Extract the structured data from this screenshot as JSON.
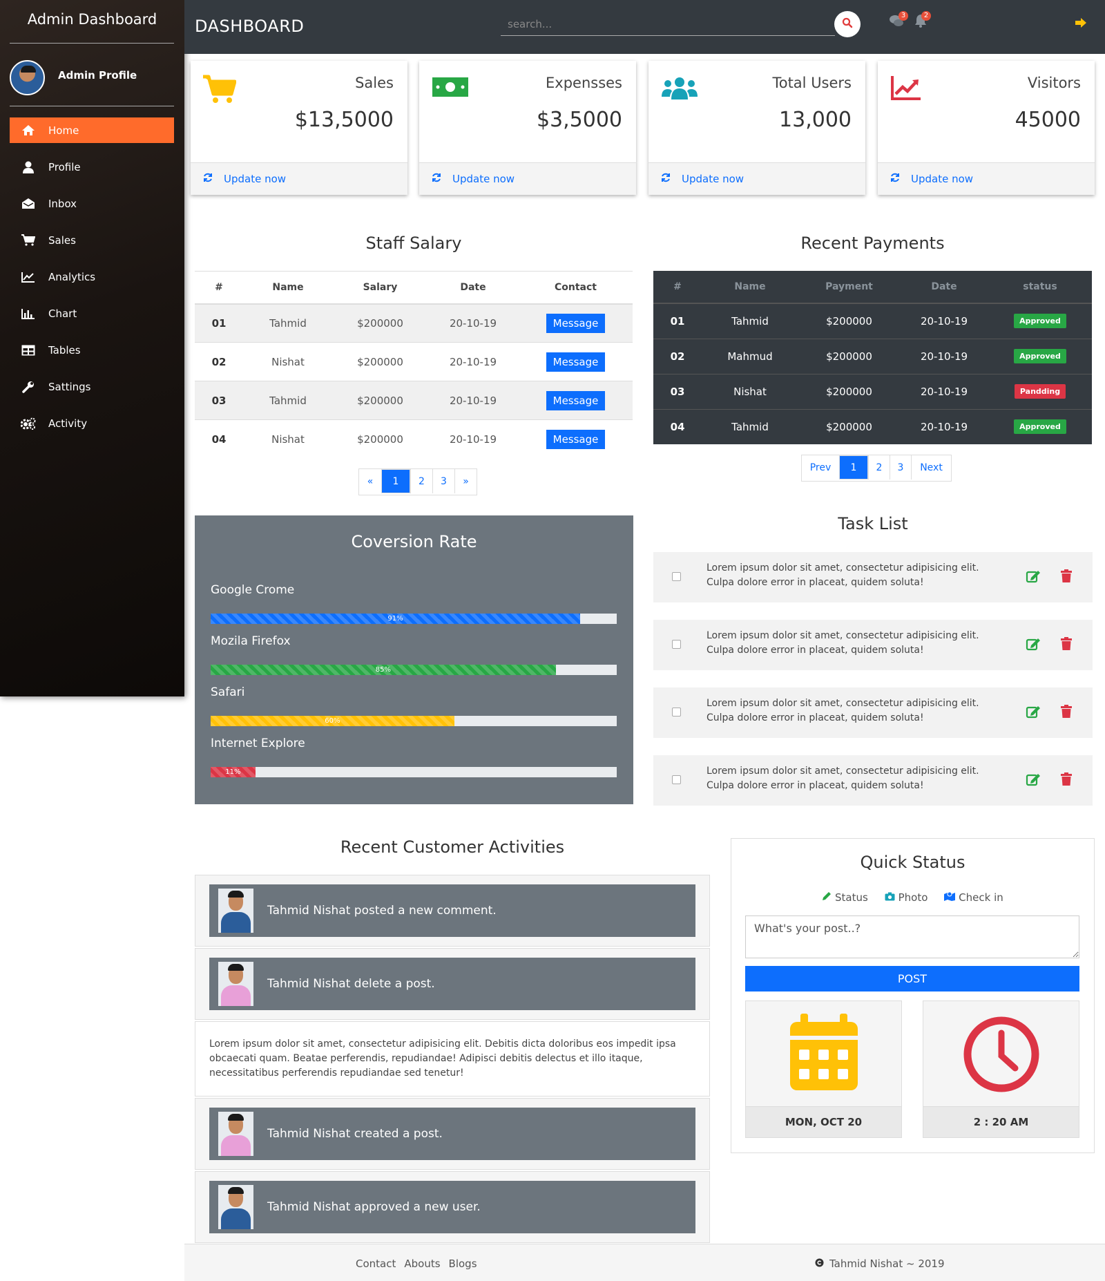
{
  "sidebar": {
    "title": "Admin Dashboard",
    "profile_name": "Admin Profile",
    "items": [
      {
        "label": "Home",
        "icon": "home-icon",
        "active": true
      },
      {
        "label": "Profile",
        "icon": "user-icon"
      },
      {
        "label": "Inbox",
        "icon": "envelope-open-icon"
      },
      {
        "label": "Sales",
        "icon": "cart-icon"
      },
      {
        "label": "Analytics",
        "icon": "line-chart-icon"
      },
      {
        "label": "Chart",
        "icon": "bar-chart-icon"
      },
      {
        "label": "Tables",
        "icon": "table-icon"
      },
      {
        "label": "Sattings",
        "icon": "wrench-icon"
      },
      {
        "label": "Activity",
        "icon": "cogs-icon"
      }
    ]
  },
  "topbar": {
    "title": "DASHBOARD",
    "search_placeholder": "search...",
    "comments_badge": "3",
    "bell_badge": "2"
  },
  "cards": [
    {
      "label": "Sales",
      "value": "$13,5000",
      "icon": "cart-icon",
      "color": "#ffc107",
      "footer": "Update now"
    },
    {
      "label": "Expensses",
      "value": "$3,5000",
      "icon": "money-icon",
      "color": "#28a745",
      "footer": "Update now"
    },
    {
      "label": "Total Users",
      "value": "13,000",
      "icon": "users-icon",
      "color": "#17a2b8",
      "footer": "Update now"
    },
    {
      "label": "Visitors",
      "value": "45000",
      "icon": "chart-line-icon",
      "color": "#dc3545",
      "footer": "Update now"
    }
  ],
  "staff_salary": {
    "title": "Staff Salary",
    "headers": [
      "#",
      "Name",
      "Salary",
      "Date",
      "Contact"
    ],
    "rows": [
      {
        "id": "01",
        "name": "Tahmid",
        "salary": "$200000",
        "date": "20-10-19",
        "action": "Message"
      },
      {
        "id": "02",
        "name": "Nishat",
        "salary": "$200000",
        "date": "20-10-19",
        "action": "Message"
      },
      {
        "id": "03",
        "name": "Tahmid",
        "salary": "$200000",
        "date": "20-10-19",
        "action": "Message"
      },
      {
        "id": "04",
        "name": "Nishat",
        "salary": "$200000",
        "date": "20-10-19",
        "action": "Message"
      }
    ],
    "pager": [
      "«",
      "1",
      "2",
      "3",
      "»"
    ]
  },
  "payments": {
    "title": "Recent Payments",
    "headers": [
      "#",
      "Name",
      "Payment",
      "Date",
      "status"
    ],
    "rows": [
      {
        "id": "01",
        "name": "Tahmid",
        "payment": "$200000",
        "date": "20-10-19",
        "status": "Approved",
        "color": "#28a745"
      },
      {
        "id": "02",
        "name": "Mahmud",
        "payment": "$200000",
        "date": "20-10-19",
        "status": "Approved",
        "color": "#28a745"
      },
      {
        "id": "03",
        "name": "Nishat",
        "payment": "$200000",
        "date": "20-10-19",
        "status": "Pandding",
        "color": "#dc3545"
      },
      {
        "id": "04",
        "name": "Tahmid",
        "payment": "$200000",
        "date": "20-10-19",
        "status": "Approved",
        "color": "#28a745"
      }
    ],
    "pager": [
      "Prev",
      "1",
      "2",
      "3",
      "Next"
    ]
  },
  "conversion": {
    "title": "Coversion Rate",
    "bars": [
      {
        "label": "Google Crome",
        "percent": 91,
        "text": "91%",
        "color": "#0d6efd"
      },
      {
        "label": "Mozila Firefox",
        "percent": 85,
        "text": "85%",
        "color": "#28a745"
      },
      {
        "label": "Safari",
        "percent": 60,
        "text": "60%",
        "color": "#ffc107"
      },
      {
        "label": "Internet Explore",
        "percent": 11,
        "text": "11%",
        "color": "#dc3545"
      }
    ]
  },
  "tasks": {
    "title": "Task List",
    "items": [
      {
        "text": "Lorem ipsum dolor sit amet, consectetur adipisicing elit. Culpa dolore error in placeat, quidem soluta!"
      },
      {
        "text": "Lorem ipsum dolor sit amet, consectetur adipisicing elit. Culpa dolore error in placeat, quidem soluta!"
      },
      {
        "text": "Lorem ipsum dolor sit amet, consectetur adipisicing elit. Culpa dolore error in placeat, quidem soluta!"
      },
      {
        "text": "Lorem ipsum dolor sit amet, consectetur adipisicing elit. Culpa dolore error in placeat, quidem soluta!"
      }
    ]
  },
  "activities": {
    "title": "Recent Customer Activities",
    "items": [
      {
        "text": "Tahmid Nishat posted a new comment.",
        "shirt": "#2b5d9a"
      },
      {
        "text": "Tahmid Nishat delete a post.",
        "shirt": "#e8a0d8"
      },
      {
        "body": "Lorem ipsum dolor sit amet, consectetur adipisicing elit. Debitis dicta doloribus eos impedit ipsa obcaecati quam. Beatae perferendis, repudiandae! Adipisci debitis delectus et illo itaque, necessitatibus perferendis repudiandae sed tenetur!"
      },
      {
        "text": "Tahmid Nishat created a post.",
        "shirt": "#e8a0d8"
      },
      {
        "text": "Tahmid Nishat approved a new user.",
        "shirt": "#2b5d9a"
      }
    ]
  },
  "quick_status": {
    "title": "Quick Status",
    "options": [
      {
        "label": "Status",
        "icon": "pencil-icon",
        "color": "#28a745"
      },
      {
        "label": "Photo",
        "icon": "camera-icon",
        "color": "#17a2b8"
      },
      {
        "label": "Check in",
        "icon": "map-icon",
        "color": "#0d6efd"
      }
    ],
    "placeholder": "What's your post..?",
    "post_label": "POST",
    "date_label": "MON, OCT 20",
    "time_label": "2 : 20 AM"
  },
  "footer": {
    "links": [
      "Contact",
      "Abouts",
      "Blogs"
    ],
    "copyright": "Tahmid Nishat ~ 2019"
  }
}
